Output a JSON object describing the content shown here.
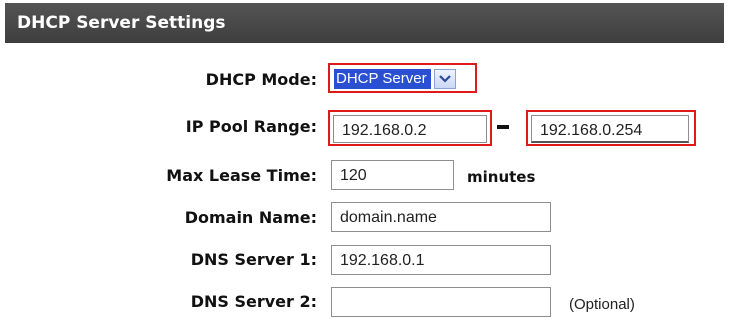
{
  "header": {
    "title": "DHCP Server Settings"
  },
  "form": {
    "dhcp_mode": {
      "label": "DHCP Mode:",
      "selected": "DHCP Server"
    },
    "ip_pool_range": {
      "label": "IP Pool Range:",
      "start": "192.168.0.2",
      "separator": "-",
      "end": "192.168.0.254"
    },
    "max_lease_time": {
      "label": "Max Lease Time:",
      "value": "120",
      "unit": "minutes"
    },
    "domain_name": {
      "label": "Domain Name:",
      "value": "domain.name"
    },
    "dns_server_1": {
      "label": "DNS Server 1:",
      "value": "192.168.0.1"
    },
    "dns_server_2": {
      "label": "DNS Server 2:",
      "value": "",
      "note": "(Optional)"
    }
  },
  "colors": {
    "highlight": "#e01a1a",
    "header_bg": "#4a4a4a",
    "selection": "#2a4fd0"
  }
}
